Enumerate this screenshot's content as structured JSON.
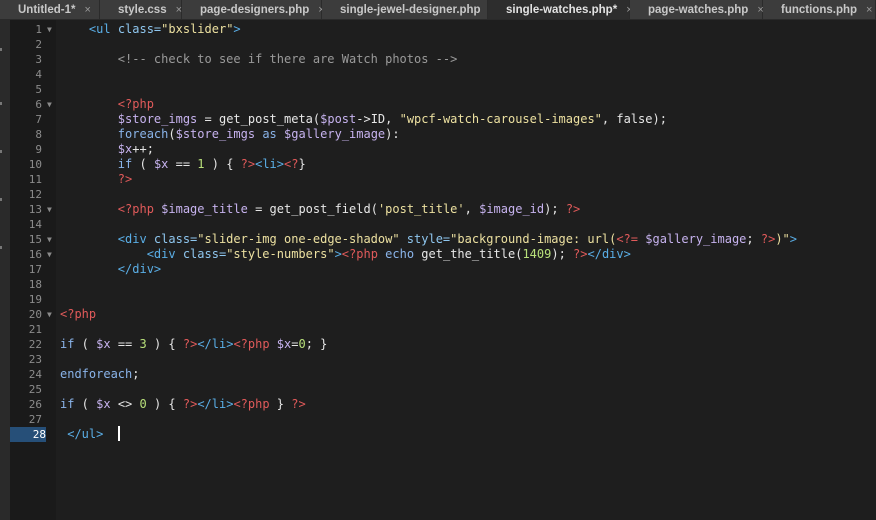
{
  "tabs": [
    {
      "label": "Untitled-1*",
      "close": "×",
      "width": 100
    },
    {
      "label": "style.css",
      "close": "×",
      "width": 82
    },
    {
      "label": "page-designers.php",
      "close": "×",
      "width": 140
    },
    {
      "label": "single-jewel-designer.php",
      "close": "×",
      "width": 166
    },
    {
      "label": "single-watches.php*",
      "close": "×",
      "width": 142
    },
    {
      "label": "page-watches.php",
      "close": "×",
      "width": 133
    },
    {
      "label": "functions.php",
      "close": "×",
      "width": 113
    }
  ],
  "active_tab_index": 4,
  "editor": {
    "current_line": 28,
    "lines": [
      {
        "n": "1",
        "fold": "▼",
        "indent": "    ",
        "tokens": [
          [
            "t-tag",
            "<ul "
          ],
          [
            "t-attr",
            "class="
          ],
          [
            "t-str",
            "\"bxslider\""
          ],
          [
            "t-tag",
            ">"
          ]
        ]
      },
      {
        "n": "2",
        "fold": "",
        "indent": "",
        "tokens": []
      },
      {
        "n": "3",
        "fold": "",
        "indent": "        ",
        "tokens": [
          [
            "t-comment",
            "<!-- check to see if there are Watch photos -->"
          ]
        ]
      },
      {
        "n": "4",
        "fold": "",
        "indent": "",
        "tokens": []
      },
      {
        "n": "5",
        "fold": "",
        "indent": "",
        "tokens": []
      },
      {
        "n": "6",
        "fold": "▼",
        "indent": "        ",
        "tokens": [
          [
            "t-php",
            "<?php"
          ]
        ]
      },
      {
        "n": "7",
        "fold": "",
        "indent": "        ",
        "tokens": [
          [
            "t-var",
            "$store_imgs"
          ],
          [
            "t-plain",
            " = "
          ],
          [
            "t-fn",
            "get_post_meta"
          ],
          [
            "t-plain",
            "("
          ],
          [
            "t-var",
            "$post"
          ],
          [
            "t-plain",
            "->ID, "
          ],
          [
            "t-str",
            "\"wpcf-watch-carousel-images\""
          ],
          [
            "t-plain",
            ", "
          ],
          [
            "t-bool",
            "false"
          ],
          [
            "t-plain",
            ");"
          ]
        ]
      },
      {
        "n": "8",
        "fold": "",
        "indent": "        ",
        "tokens": [
          [
            "t-kw",
            "foreach"
          ],
          [
            "t-plain",
            "("
          ],
          [
            "t-var",
            "$store_imgs"
          ],
          [
            "t-plain",
            " "
          ],
          [
            "t-kw",
            "as"
          ],
          [
            "t-plain",
            " "
          ],
          [
            "t-var",
            "$gallery_image"
          ],
          [
            "t-plain",
            "):"
          ]
        ]
      },
      {
        "n": "9",
        "fold": "",
        "indent": "        ",
        "tokens": [
          [
            "t-var",
            "$x"
          ],
          [
            "t-plain",
            "++;"
          ]
        ]
      },
      {
        "n": "10",
        "fold": "",
        "indent": "        ",
        "tokens": [
          [
            "t-kw",
            "if"
          ],
          [
            "t-plain",
            " ( "
          ],
          [
            "t-var",
            "$x"
          ],
          [
            "t-plain",
            " == "
          ],
          [
            "t-num",
            "1"
          ],
          [
            "t-plain",
            " ) { "
          ],
          [
            "t-php",
            "?>"
          ],
          [
            "t-tag",
            "<li>"
          ],
          [
            "t-php",
            "<?"
          ],
          [
            "t-plain",
            "}"
          ]
        ]
      },
      {
        "n": "11",
        "fold": "",
        "indent": "        ",
        "tokens": [
          [
            "t-php",
            "?>"
          ]
        ]
      },
      {
        "n": "12",
        "fold": "",
        "indent": "",
        "tokens": []
      },
      {
        "n": "13",
        "fold": "▼",
        "indent": "        ",
        "tokens": [
          [
            "t-php",
            "<?php "
          ],
          [
            "t-var",
            "$image_title"
          ],
          [
            "t-plain",
            " = "
          ],
          [
            "t-fn",
            "get_post_field"
          ],
          [
            "t-plain",
            "("
          ],
          [
            "t-str",
            "'post_title'"
          ],
          [
            "t-plain",
            ", "
          ],
          [
            "t-var",
            "$image_id"
          ],
          [
            "t-plain",
            "); "
          ],
          [
            "t-php",
            "?>"
          ]
        ]
      },
      {
        "n": "14",
        "fold": "",
        "indent": "",
        "tokens": []
      },
      {
        "n": "15",
        "fold": "▼",
        "indent": "        ",
        "tokens": [
          [
            "t-tag",
            "<div "
          ],
          [
            "t-attr",
            "class="
          ],
          [
            "t-str",
            "\"slider-img one-edge-shadow\""
          ],
          [
            "t-attr",
            " style="
          ],
          [
            "t-str",
            "\"background-image: url("
          ],
          [
            "t-php",
            "<?="
          ],
          [
            "t-plain",
            " "
          ],
          [
            "t-var",
            "$gallery_image"
          ],
          [
            "t-plain",
            "; "
          ],
          [
            "t-php",
            "?>"
          ],
          [
            "t-str",
            ")\""
          ],
          [
            "t-tag",
            ">"
          ]
        ]
      },
      {
        "n": "16",
        "fold": "▼",
        "indent": "            ",
        "tokens": [
          [
            "t-tag",
            "<div "
          ],
          [
            "t-attr",
            "class="
          ],
          [
            "t-str",
            "\"style-numbers\""
          ],
          [
            "t-tag",
            ">"
          ],
          [
            "t-php",
            "<?php "
          ],
          [
            "t-kw",
            "echo"
          ],
          [
            "t-plain",
            " "
          ],
          [
            "t-fn",
            "get_the_title"
          ],
          [
            "t-plain",
            "("
          ],
          [
            "t-num",
            "1409"
          ],
          [
            "t-plain",
            "); "
          ],
          [
            "t-php",
            "?>"
          ],
          [
            "t-tag",
            "</div>"
          ]
        ]
      },
      {
        "n": "17",
        "fold": "",
        "indent": "        ",
        "tokens": [
          [
            "t-tag",
            "</div>"
          ]
        ]
      },
      {
        "n": "18",
        "fold": "",
        "indent": "",
        "tokens": []
      },
      {
        "n": "19",
        "fold": "",
        "indent": "",
        "tokens": []
      },
      {
        "n": "20",
        "fold": "▼",
        "indent": "",
        "tokens": [
          [
            "t-php",
            "<?php"
          ]
        ]
      },
      {
        "n": "21",
        "fold": "",
        "indent": "",
        "tokens": []
      },
      {
        "n": "22",
        "fold": "",
        "indent": "",
        "tokens": [
          [
            "t-kw",
            "if"
          ],
          [
            "t-plain",
            " ( "
          ],
          [
            "t-var",
            "$x"
          ],
          [
            "t-plain",
            " == "
          ],
          [
            "t-num",
            "3"
          ],
          [
            "t-plain",
            " ) { "
          ],
          [
            "t-php",
            "?>"
          ],
          [
            "t-tag",
            "</li>"
          ],
          [
            "t-php",
            "<?php "
          ],
          [
            "t-var",
            "$x"
          ],
          [
            "t-plain",
            "="
          ],
          [
            "t-num",
            "0"
          ],
          [
            "t-plain",
            "; }"
          ]
        ]
      },
      {
        "n": "23",
        "fold": "",
        "indent": "",
        "tokens": []
      },
      {
        "n": "24",
        "fold": "",
        "indent": "",
        "tokens": [
          [
            "t-kw",
            "endforeach"
          ],
          [
            "t-plain",
            ";"
          ]
        ]
      },
      {
        "n": "25",
        "fold": "",
        "indent": "",
        "tokens": []
      },
      {
        "n": "26",
        "fold": "",
        "indent": "",
        "tokens": [
          [
            "t-kw",
            "if"
          ],
          [
            "t-plain",
            " ( "
          ],
          [
            "t-var",
            "$x"
          ],
          [
            "t-plain",
            " <> "
          ],
          [
            "t-num",
            "0"
          ],
          [
            "t-plain",
            " ) { "
          ],
          [
            "t-php",
            "?>"
          ],
          [
            "t-tag",
            "</li>"
          ],
          [
            "t-php",
            "<?php"
          ],
          [
            "t-plain",
            " } "
          ],
          [
            "t-php",
            "?>"
          ]
        ]
      },
      {
        "n": "27",
        "fold": "",
        "indent": "",
        "tokens": []
      },
      {
        "n": "28",
        "fold": "",
        "indent": " ",
        "tokens": [
          [
            "t-tag",
            "</ul>"
          ]
        ]
      }
    ]
  }
}
